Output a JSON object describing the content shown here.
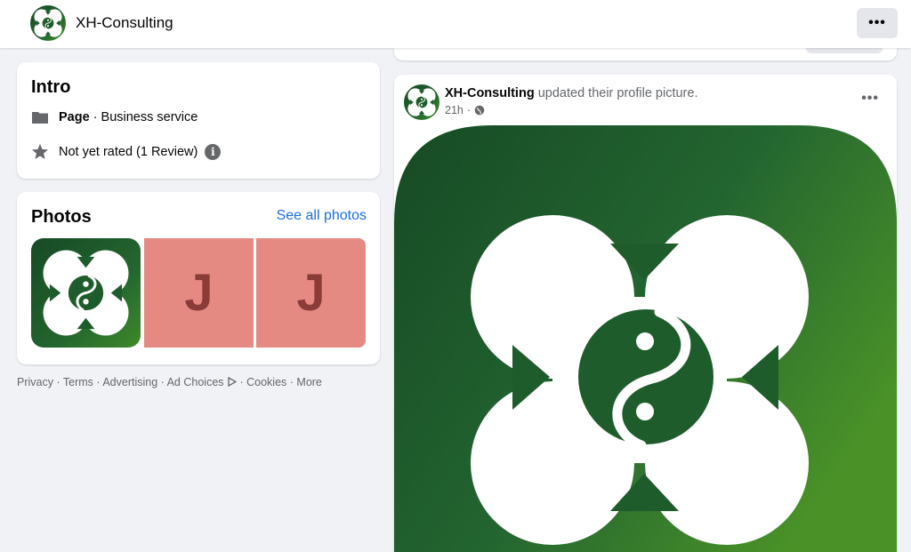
{
  "header": {
    "page_name": "XH-Consulting",
    "more_label": "•••"
  },
  "intro": {
    "title": "Intro",
    "category_bold": "Page",
    "category_rest": "· Business service",
    "rating": "Not yet rated (1 Review)",
    "info_glyph": "i"
  },
  "photos": {
    "title": "Photos",
    "see_all": "See all photos",
    "thumbnails": [
      {
        "kind": "logo"
      },
      {
        "kind": "letter",
        "letter": "J"
      },
      {
        "kind": "letter",
        "letter": "J"
      }
    ]
  },
  "footer": {
    "links": [
      "Privacy",
      "Terms",
      "Advertising",
      "Ad Choices",
      "Cookies",
      "More"
    ]
  },
  "post": {
    "author": "XH-Consulting",
    "action": "updated their profile picture.",
    "time": "21h",
    "separator": "·",
    "more_label": "•••"
  },
  "colors": {
    "brand_green": "#1f5c2c",
    "link_blue": "#1b6fd9",
    "thumb_pink": "#e58a82"
  },
  "icons": [
    "xh-logo-icon",
    "page-flag-icon",
    "star-icon",
    "info-icon",
    "globe-icon",
    "ad-choices-icon",
    "more-dots-icon"
  ]
}
